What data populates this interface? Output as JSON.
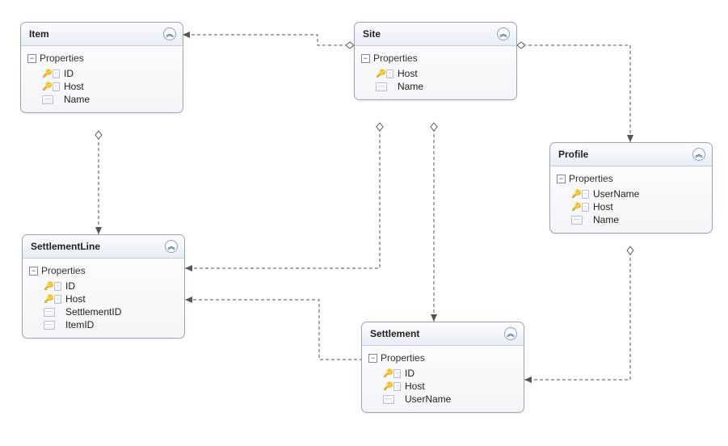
{
  "labels": {
    "properties": "Properties"
  },
  "entities": {
    "item": {
      "name": "Item",
      "props": [
        "ID",
        "Host",
        "Name"
      ],
      "keys": [
        "ID",
        "Host"
      ]
    },
    "site": {
      "name": "Site",
      "props": [
        "Host",
        "Name"
      ],
      "keys": [
        "Host"
      ]
    },
    "profile": {
      "name": "Profile",
      "props": [
        "UserName",
        "Host",
        "Name"
      ],
      "keys": [
        "UserName",
        "Host"
      ]
    },
    "settlementLine": {
      "name": "SettlementLine",
      "props": [
        "ID",
        "Host",
        "SettlementID",
        "ItemID"
      ],
      "keys": [
        "ID",
        "Host"
      ]
    },
    "settlement": {
      "name": "Settlement",
      "props": [
        "ID",
        "Host",
        "UserName"
      ],
      "keys": [
        "ID",
        "Host"
      ]
    }
  },
  "relationships": [
    {
      "from": "Site",
      "to": "Item"
    },
    {
      "from": "Site",
      "to": "SettlementLine"
    },
    {
      "from": "Site",
      "to": "Settlement"
    },
    {
      "from": "Site",
      "to": "Profile"
    },
    {
      "from": "Item",
      "to": "SettlementLine"
    },
    {
      "from": "Settlement",
      "to": "SettlementLine"
    },
    {
      "from": "Profile",
      "to": "Settlement"
    }
  ]
}
